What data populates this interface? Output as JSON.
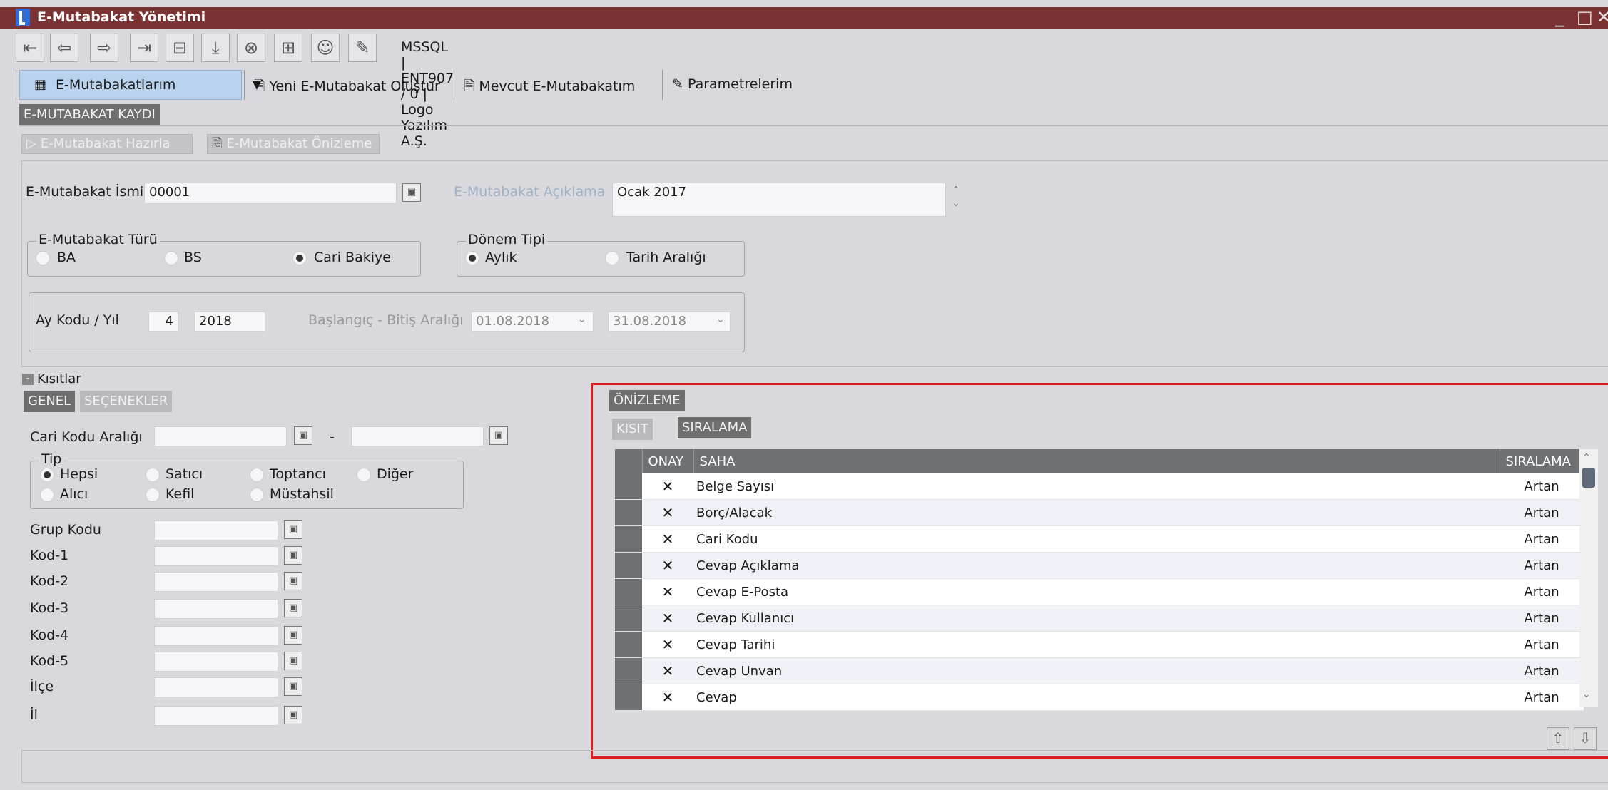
{
  "window": {
    "title": "E-Mutabakat Yönetimi"
  },
  "toolbar": {
    "connection": "MSSQL | ENT907 / 0 | Logo Yazılım A.Ş."
  },
  "menu": {
    "dropdown_label": "E-Mutabakatlarım",
    "items": [
      "Yeni E-Mutabakat Oluştur",
      "Mevcut E-Mutabakatım",
      "Parametrelerim"
    ]
  },
  "section_title": "E-MUTABAKAT KAYDI",
  "actions": {
    "prepare": "E-Mutabakat Hazırla",
    "preview": "E-Mutabakat Önizleme"
  },
  "form": {
    "name_label": "E-Mutabakat İsmi",
    "name_value": "00001",
    "desc_label": "E-Mutabakat Açıklama",
    "desc_value": "Ocak 2017",
    "type_group": "E-Mutabakat Türü",
    "type_options": [
      "BA",
      "BS",
      "Cari Bakiye"
    ],
    "period_group": "Dönem Tipi",
    "period_options": [
      "Aylık",
      "Tarih Aralığı"
    ],
    "month_label": "Ay Kodu / Yıl",
    "month_value": "4",
    "year_value": "2018",
    "range_label": "Başlangıç - Bitiş Aralığı",
    "start_date": "01.08.2018",
    "end_date": "31.08.2018"
  },
  "constraints": {
    "title": "Kısıtlar",
    "tabs": [
      "GENEL",
      "SEÇENEKLER"
    ],
    "cari_label": "Cari Kodu Aralığı",
    "dash": "-",
    "tip_group": "Tip",
    "tip_options": [
      "Hepsi",
      "Satıcı",
      "Toptancı",
      "Diğer",
      "Alıcı",
      "Kefil",
      "Müstahsil"
    ],
    "fields": [
      "Grup Kodu",
      "Kod-1",
      "Kod-2",
      "Kod-3",
      "Kod-4",
      "Kod-5",
      "İlçe",
      "İl"
    ]
  },
  "preview": {
    "title": "ÖNİZLEME",
    "tabs": [
      "KISIT",
      "SIRALAMA"
    ],
    "columns": [
      "ONAY",
      "SAHA",
      "SIRALAMA"
    ],
    "rows": [
      {
        "mark": "✕",
        "field": "Belge Sayısı",
        "order": "Artan"
      },
      {
        "mark": "✕",
        "field": "Borç/Alacak",
        "order": "Artan"
      },
      {
        "mark": "✕",
        "field": "Cari Kodu",
        "order": "Artan"
      },
      {
        "mark": "✕",
        "field": "Cevap Açıklama",
        "order": "Artan"
      },
      {
        "mark": "✕",
        "field": "Cevap E-Posta",
        "order": "Artan"
      },
      {
        "mark": "✕",
        "field": "Cevap Kullanıcı",
        "order": "Artan"
      },
      {
        "mark": "✕",
        "field": "Cevap Tarihi",
        "order": "Artan"
      },
      {
        "mark": "✕",
        "field": "Cevap Unvan",
        "order": "Artan"
      },
      {
        "mark": "✕",
        "field": "Cevap",
        "order": "Artan"
      }
    ]
  },
  "colors": {
    "titlebar": "#7b3232",
    "highlight": "#e02020",
    "grid_header": "#6e7174"
  }
}
